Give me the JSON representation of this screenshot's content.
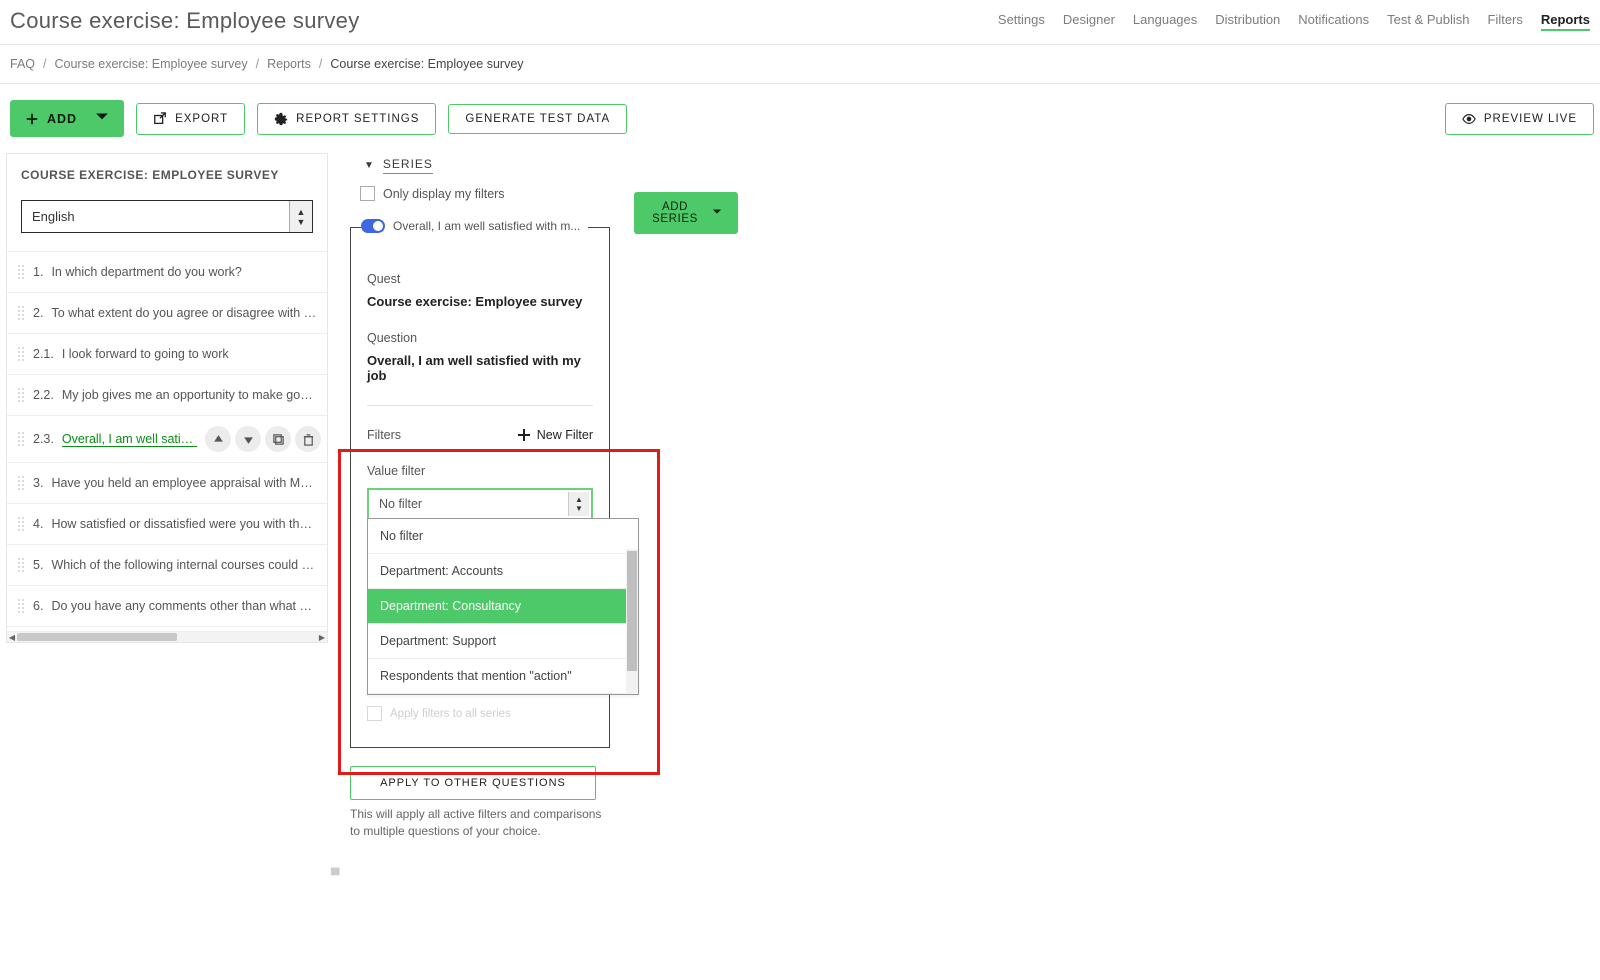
{
  "header": {
    "title": "Course exercise: Employee survey",
    "nav": [
      "Settings",
      "Designer",
      "Languages",
      "Distribution",
      "Notifications",
      "Test & Publish",
      "Filters",
      "Reports"
    ],
    "active_nav": "Reports"
  },
  "breadcrumb": {
    "items": [
      "FAQ",
      "Course exercise: Employee survey",
      "Reports",
      "Course exercise: Employee survey"
    ]
  },
  "toolbar": {
    "add": "ADD",
    "export": "EXPORT",
    "report_settings": "REPORT SETTINGS",
    "generate_test": "GENERATE TEST DATA",
    "preview": "PREVIEW LIVE"
  },
  "sidebar": {
    "title": "COURSE EXERCISE: EMPLOYEE SURVEY",
    "language": "English",
    "items": [
      {
        "num": "1.",
        "text": "In which department do you work?"
      },
      {
        "num": "2.",
        "text": "To what extent do you agree or disagree with the fo"
      },
      {
        "num": "2.1.",
        "text": "I look forward to going to work"
      },
      {
        "num": "2.2.",
        "text": "My job gives me an opportunity to make good us"
      },
      {
        "num": "2.3.",
        "text": "Overall, I am well satisfi...",
        "active": true
      },
      {
        "num": "3.",
        "text": "Have you held an employee appraisal with MANAGE"
      },
      {
        "num": "4.",
        "text": "How satisfied or dissatisfied were you with the emp"
      },
      {
        "num": "5.",
        "text": "Which of the following internal courses could you in"
      },
      {
        "num": "6.",
        "text": "Do you have any comments other than what you ha"
      }
    ]
  },
  "config": {
    "section": "SERIES",
    "only_my_filters": "Only display my filters",
    "add_series": "ADD SERIES",
    "legend_chip": "Overall, I am well satisfied with m...",
    "quest_label": "Quest",
    "quest_value": "Course exercise: Employee survey",
    "question_label": "Question",
    "question_value": "Overall, I am well satisfied with my job",
    "filters_label": "Filters",
    "new_filter": "New Filter",
    "value_filter_label": "Value filter",
    "value_filter_selected": "No filter",
    "dropdown_options": [
      "No filter",
      "Department: Accounts",
      "Department: Consultancy",
      "Department: Support",
      "Respondents that mention \"action\""
    ],
    "dropdown_highlight_index": 2,
    "apply_all_ghost": "Apply filters to all series",
    "apply_button": "APPLY TO OTHER QUESTIONS",
    "apply_note": "This will apply all active filters and comparisons to multiple questions of your choice."
  }
}
